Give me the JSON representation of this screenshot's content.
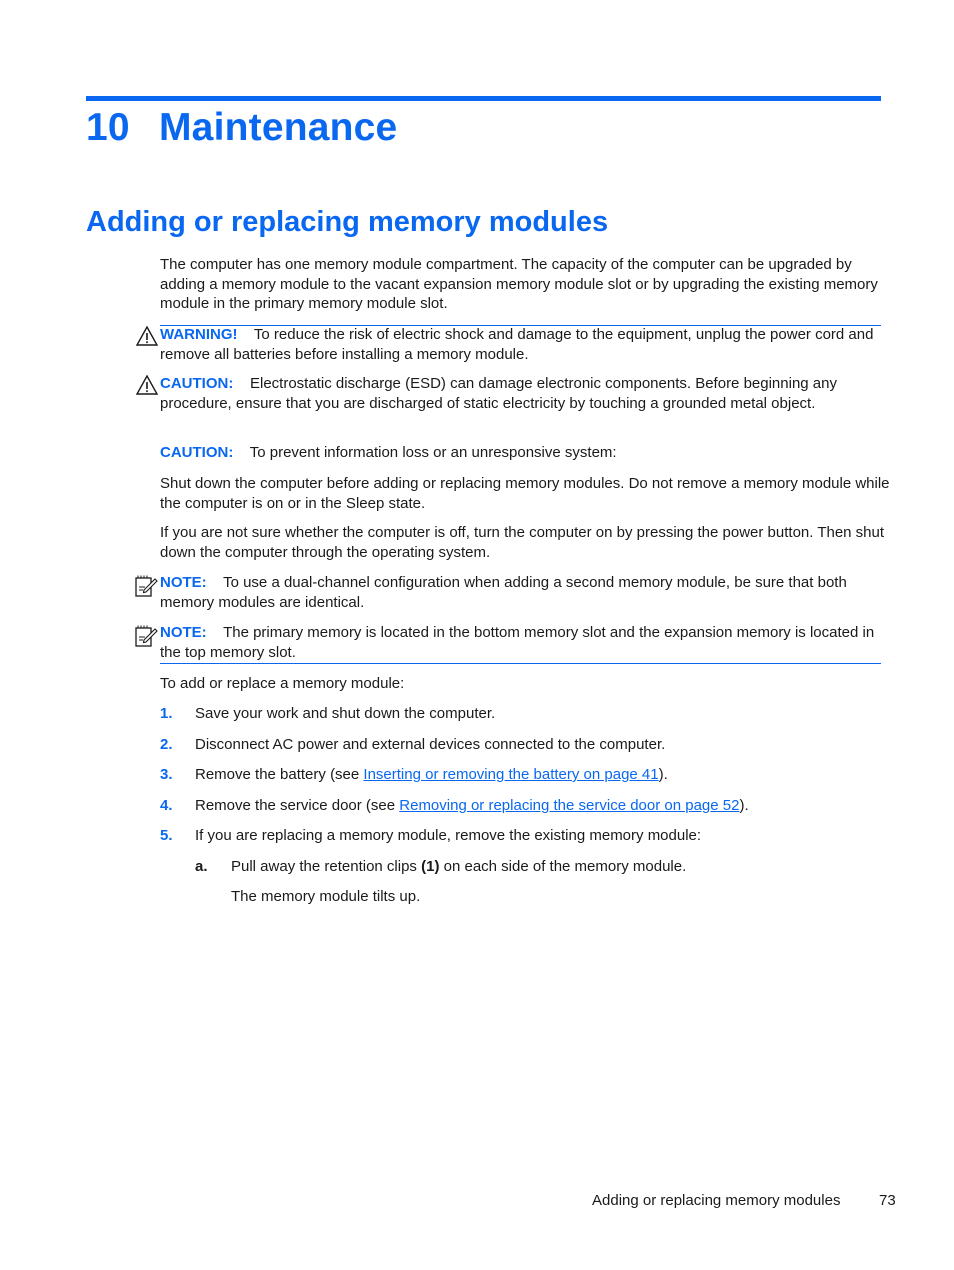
{
  "chapter": {
    "number": "10",
    "title": "Maintenance"
  },
  "section": {
    "title": "Adding or replacing memory modules"
  },
  "intro": "The computer has one memory module compartment. The capacity of the computer can be upgraded by adding a memory module to the vacant expansion memory module slot or by upgrading the existing memory module in the primary memory module slot.",
  "notices": [
    {
      "type": "warning",
      "icon": "warning-triangle-icon",
      "label": "WARNING!",
      "text": "To reduce the risk of electric shock and damage to the equipment, unplug the power cord and remove all batteries before installing a memory module."
    },
    {
      "type": "caution",
      "icon": "warning-triangle-icon",
      "label": "CAUTION:",
      "text": "Electrostatic discharge (ESD) can damage electronic components. Before beginning any procedure, ensure that you are discharged of static electricity by touching a grounded metal object."
    },
    {
      "type": "caution",
      "icon": "",
      "label": "CAUTION:",
      "text": "To prevent information loss or an unresponsive system:"
    },
    {
      "type": "note",
      "icon": "note-pad-icon",
      "label": "NOTE:",
      "text": "To use a dual-channel configuration when adding a second memory module, be sure that both memory modules are identical."
    },
    {
      "type": "note",
      "icon": "note-pad-icon",
      "label": "NOTE:",
      "text": "The primary memory is located in the bottom memory slot and the expansion memory is located in the top memory slot."
    }
  ],
  "caution_paras": [
    "Shut down the computer before adding or replacing memory modules. Do not remove a memory module while the computer is on or in the Sleep state.",
    "If you are not sure whether the computer is off, turn the computer on by pressing the power button. Then shut down the computer through the operating system."
  ],
  "procedure_intro": "To add or replace a memory module:",
  "steps": [
    {
      "num": "1.",
      "text": "Save your work and shut down the computer."
    },
    {
      "num": "2.",
      "text": "Disconnect AC power and external devices connected to the computer."
    },
    {
      "num": "3.",
      "pre": "Remove the battery (see ",
      "link": "Inserting or removing the battery on page 41",
      "post": ")."
    },
    {
      "num": "4.",
      "pre": "Remove the service door (see ",
      "link": "Removing or replacing the service door on page 52",
      "post": ")."
    },
    {
      "num": "5.",
      "text": "If you are replacing a memory module, remove the existing memory module:"
    }
  ],
  "substeps": [
    {
      "num": "a.",
      "pre": "Pull away the retention clips ",
      "bold": "(1)",
      "post": " on each side of the memory module.",
      "result": "The memory module tilts up."
    }
  ],
  "footer": {
    "section": "Adding or replacing memory modules",
    "page": "73"
  },
  "colors": {
    "accent": "#0a68f0",
    "text": "#1a1a1a"
  }
}
